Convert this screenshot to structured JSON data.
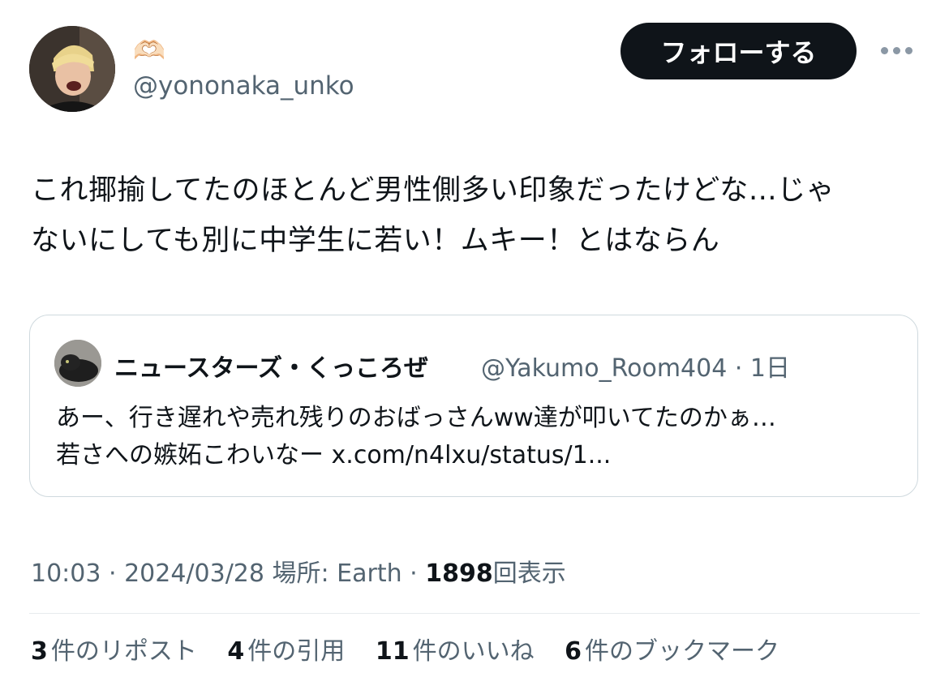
{
  "author": {
    "display_name": "🫶🏻",
    "handle": "@yononaka_unko"
  },
  "follow_label": "フォローする",
  "more_icon": "more-horizontal-icon",
  "tweet": {
    "lines": [
      "これ揶揄してたのほとんど男性側多い印象だったけどな…じゃ",
      "ないにしても別に中学生に若い！ムキー！とはならん"
    ]
  },
  "quote": {
    "name": "ニュースターズ・くっころぜ",
    "handle_time": "@Yakumo_Room404 · 1日",
    "lines": [
      "あー、行き遅れや売れ残りのおばっさんww達が叩いてたのかぁ…",
      "若さへの嫉妬こわいなー x.com/n4lxu/status/1..."
    ]
  },
  "meta": {
    "time_date_place": "10:03 · 2024/03/28 場所: Earth · ",
    "views_count": "1898",
    "views_label": "回表示"
  },
  "stats": [
    {
      "count": "3",
      "label": "件のリポスト"
    },
    {
      "count": "4",
      "label": "件の引用"
    },
    {
      "count": "11",
      "label": "件のいいね"
    },
    {
      "count": "6",
      "label": "件のブックマーク"
    }
  ]
}
